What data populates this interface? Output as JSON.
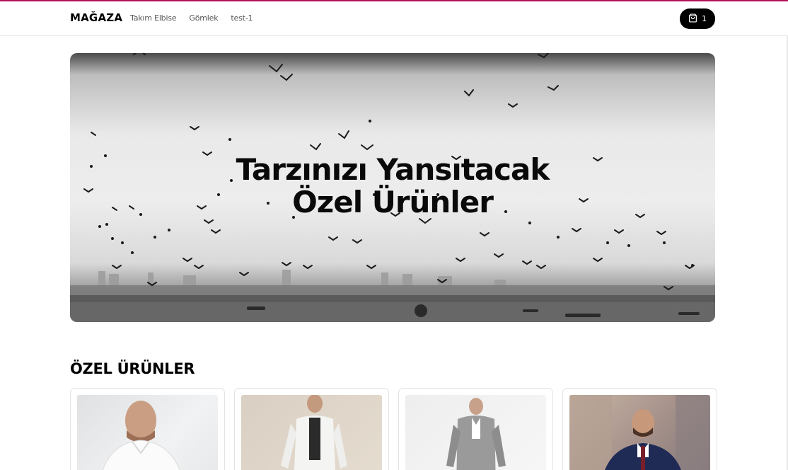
{
  "header": {
    "logo": "MAĞAZA",
    "nav": [
      "Takım Elbise",
      "Gömlek",
      "test-1"
    ],
    "cart_icon": "shopping-bag-icon",
    "cart_count": "1"
  },
  "hero": {
    "title_line1": "Tarzınızı Yansıtacak",
    "title_line2": "Özel Ürünler",
    "image": "black-and-white seaside with flock of birds"
  },
  "featured": {
    "title": "ÖZEL ÜRÜNLER",
    "products": [
      {
        "image": "man in white shirt"
      },
      {
        "image": "man in white suit"
      },
      {
        "image": "man in grey suit"
      },
      {
        "image": "man in navy three-piece suit"
      }
    ]
  },
  "colors": {
    "accent": "#b0125b",
    "text": "#111111",
    "cart_button": "#000000"
  }
}
